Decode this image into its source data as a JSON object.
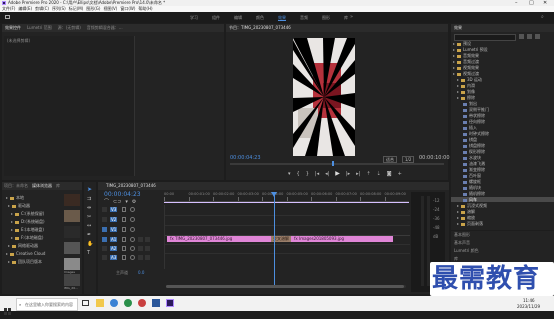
{
  "window": {
    "title": "Adobe Premiere Pro 2020 - C:\\用户\\Ellips\\文档\\Adobe\\Premiere Pro\\14.0\\未命名 *",
    "menu": [
      "文件(F)",
      "编辑(E)",
      "剪辑(C)",
      "序列(S)",
      "标记(M)",
      "图形(G)",
      "视图(V)",
      "窗口(W)",
      "帮助(H)"
    ]
  },
  "workspaces": [
    "学习",
    "组件",
    "编辑",
    "颜色",
    "效果",
    "音频",
    "图形",
    "库"
  ],
  "workspace_active": "效果",
  "left_panel": {
    "tabs": [
      "效果控件",
      "Lumetri 范围",
      "源：(无剪辑)",
      "音频剪辑混合器：..."
    ],
    "placeholder": "(未选择剪辑)"
  },
  "program_monitor": {
    "tab": "节目：TIMG_20230807_073446",
    "timecode_current": "00:00:04:23",
    "fit": "适合",
    "ratio": "1/2",
    "timecode_total": "00:00:10:00"
  },
  "project_panel": {
    "tabs": [
      "项目：未命名",
      "媒体浏览器",
      "库"
    ],
    "tree": [
      "本地",
      "驱动器",
      "C:(系统保留)",
      "D:(系统磁盘)",
      "E:(本地磁盘)",
      "F:(本地磁盘)",
      "网络驱动器",
      "Creative Cloud",
      "团队项目版本"
    ],
    "thumb_labels": [
      "",
      "",
      "",
      "",
      "Images",
      "IMG_20..."
    ]
  },
  "timeline": {
    "tab": "TIMG_20230807_073446",
    "timecode": "00:00:04:23",
    "ruler": [
      "00:00",
      "00:00:01:00",
      "00:00:02:00",
      "00:00:03:00",
      "00:00:04:00",
      "00:00:05:00",
      "00:00:06:00",
      "00:00:07:00",
      "00:00:08:00",
      "00:00:09:00"
    ],
    "tracks": [
      "V3",
      "V2",
      "V1",
      "A1",
      "A2",
      "A3"
    ],
    "master": "主声道",
    "master_value": "0.0",
    "clip1": "fx TIMG_20230807_073446.jpg",
    "transition": "交叉溶解",
    "clip2": "fx Images201805093.jpg"
  },
  "effects_panel": {
    "tab": "效果",
    "tree": [
      "预设",
      "Lumetri 预设",
      "音频效果",
      "音频过渡",
      "视频效果",
      "视频过渡",
      "3D 运动",
      "内滑",
      "划像",
      "擦除",
      "划出",
      "双侧平推门",
      "带状擦除",
      "径向擦除",
      "插入",
      "时钟式擦除",
      "棋盘",
      "棋盘擦除",
      "楔形擦除",
      "水波块",
      "油漆飞溅",
      "渐变擦除",
      "百叶窗",
      "螺旋框",
      "随机块",
      "随机擦除",
      "风车",
      "沉浸式视频",
      "溶解",
      "缩放",
      "页面剥落"
    ],
    "highlight_index": 26,
    "lower": [
      "基本图形",
      "基本声音",
      "Lumetri 颜色",
      "库",
      "标记",
      "历史记录",
      "信息"
    ]
  },
  "taskbar": {
    "search_placeholder": "在这里输入你要搜索的内容",
    "time": "11:46",
    "date": "2023/11/29"
  },
  "watermark": "最需教育",
  "colors": {
    "accent": "#4d8fe0",
    "clip": "#df85d6",
    "transition": "#9a7e6a",
    "playhead": "#4d8fe0",
    "highlight_row": "#4a4a4a"
  }
}
